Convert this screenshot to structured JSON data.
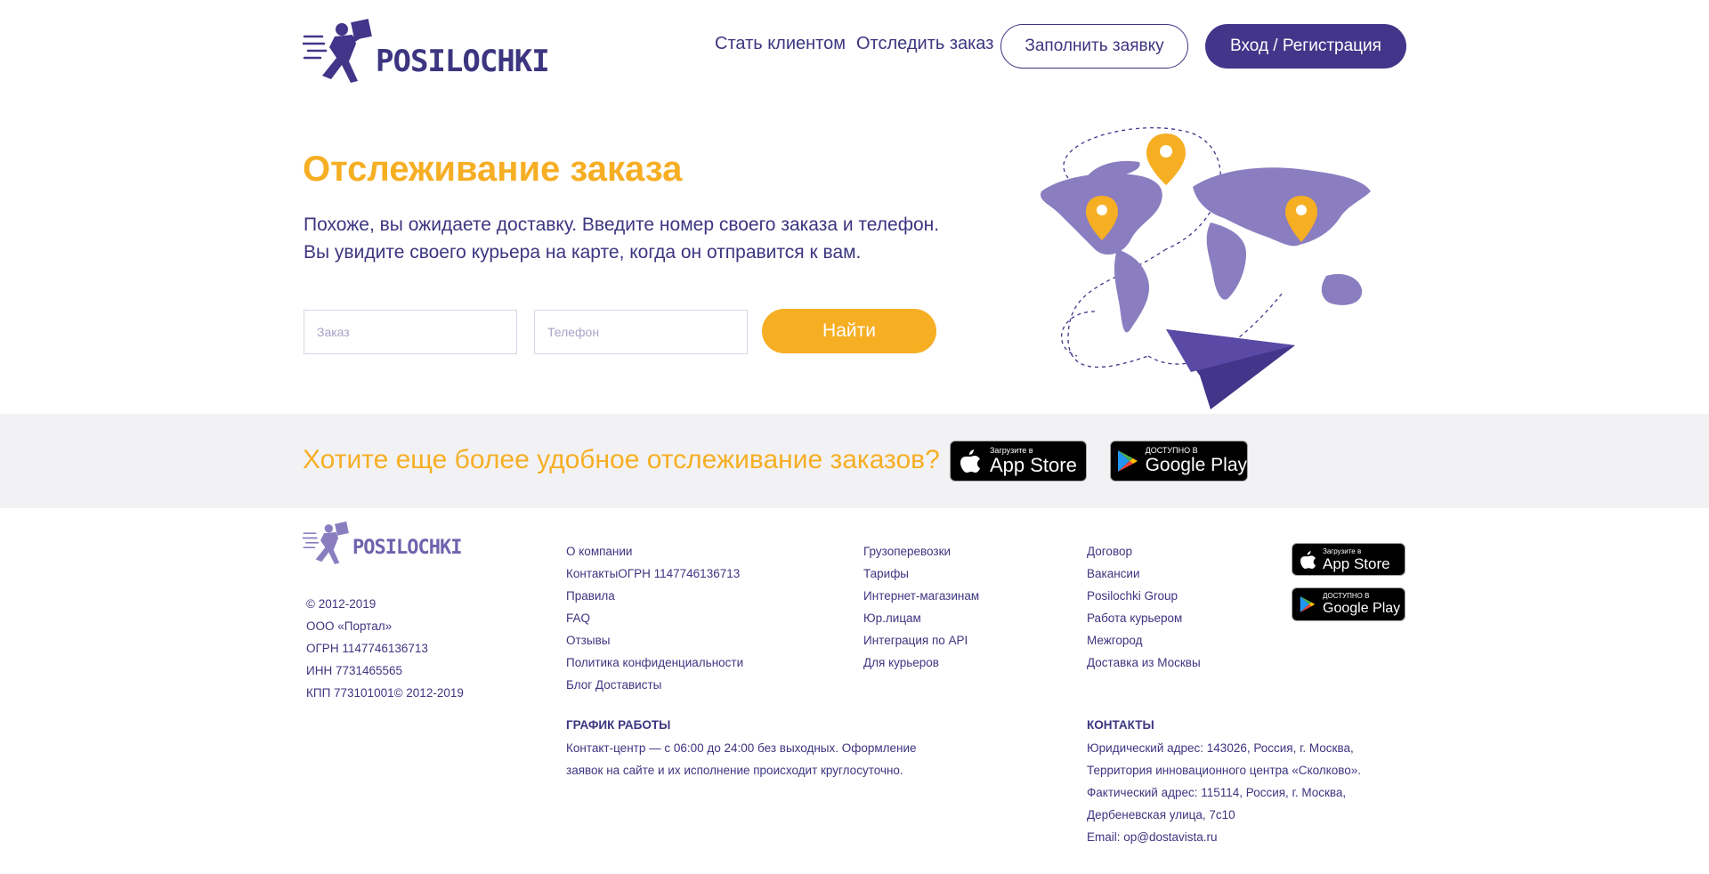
{
  "header": {
    "logo_text": "POSILOCHKI",
    "nav": [
      "Стать клиентом",
      "Отследить заказ"
    ],
    "fill_request": "Заполнить заявку",
    "login": "Вход / Регистрация"
  },
  "hero": {
    "title": "Отслеживание заказа",
    "line1": "Похоже, вы ожидаете доставку. Введите номер своего заказа и телефон.",
    "line2": "Вы увидите своего курьера на карте, когда он отправится к вам.",
    "order_placeholder": "Заказ",
    "phone_placeholder": "Телефон",
    "find_button": "Найти"
  },
  "banner": {
    "text": "Хотите еще более удобное отслеживание заказов?",
    "appstore_small": "Загрузите в",
    "appstore_big": "App Store",
    "googleplay_small": "ДОСТУПНО В",
    "googleplay_big": "Google Play"
  },
  "footer": {
    "logo_text": "POSILOCHKI",
    "legal": [
      "© 2012-2019",
      "ООО «Портал»",
      "ОГРН 1147746136713",
      "ИНН 7731465565",
      "КПП 773101001© 2012-2019"
    ],
    "col1": [
      "О компании",
      "КонтактыОГРН 1147746136713",
      "Правила",
      "FAQ",
      "Отзывы",
      "Политика конфиденциальности",
      "Блог Достависты"
    ],
    "col2": [
      "Грузоперевозки",
      "Тарифы",
      "Интернет-магазинам",
      "Юр.лицам",
      "Интеграция по API",
      "Для курьеров"
    ],
    "col3": [
      "Договор",
      "Вакансии",
      "Posilochki Group",
      "Работа курьером",
      "Межгород",
      "Доставка из Москвы"
    ],
    "schedule": {
      "heading": "ГРАФИК РАБОТЫ",
      "line1": "Контакт-центр — с 06:00 до 24:00 без выходных. Оформление",
      "line2": "заявок на сайте и их исполнение происходит круглосуточно."
    },
    "contacts": {
      "heading": "КОНТАКТЫ",
      "line1": "Юридический адрес: 143026, Россия, г. Москва,",
      "line2": "Территория инновационного центра «Сколково».",
      "line3": "Фактический адрес: 115114, Россия, г. Москва,",
      "line4": "Дербеневская улица, 7с10",
      "email_label": "Email: ",
      "email": "op@dostavista.ru"
    },
    "appstore_small": "Загрузите в",
    "appstore_big": "App Store",
    "googleplay_small": "ДОСТУПНО В",
    "googleplay_big": "Google Play"
  },
  "colors": {
    "brand_purple": "#433589",
    "accent_orange": "#f6ae23",
    "map_purple": "#8a7ec0"
  },
  "icons": [
    "courier-logo-icon",
    "apple-icon",
    "google-play-icon",
    "location-pin-icon",
    "paper-plane-icon"
  ]
}
